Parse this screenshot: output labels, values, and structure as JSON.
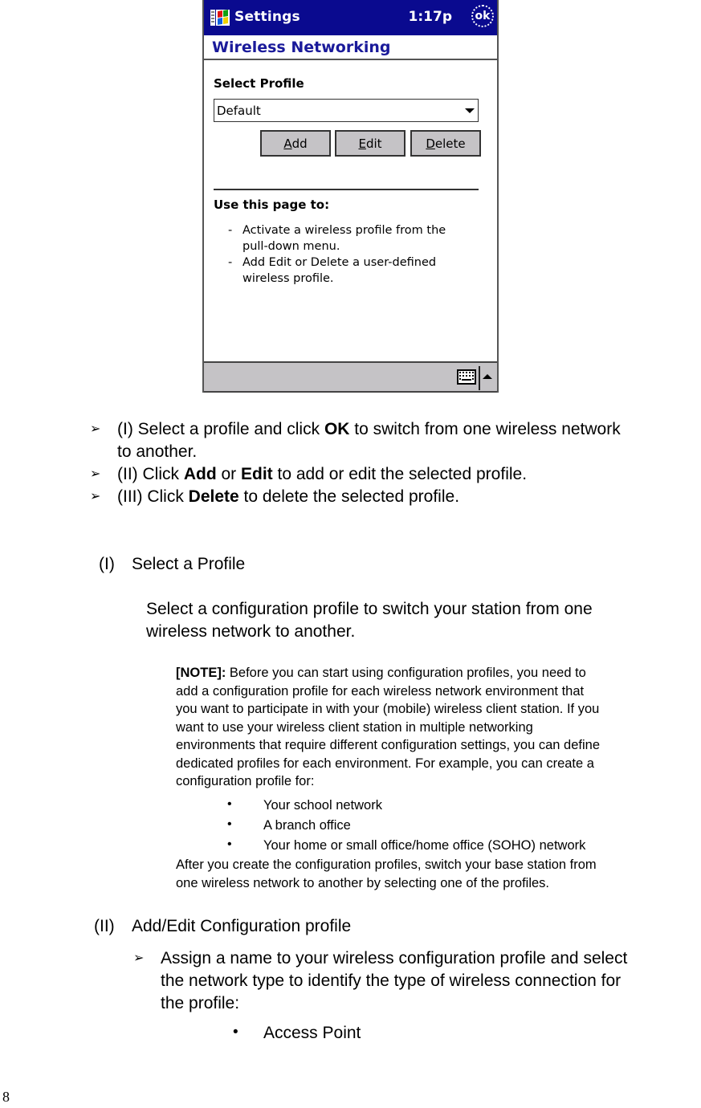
{
  "screenshot": {
    "title_bar": {
      "app_title": "Settings",
      "time": "1:17p",
      "ok_label": "ok",
      "start_icon": "windows-flag-icon",
      "color": "#0a0a8f"
    },
    "header": {
      "title": "Wireless Networking",
      "color": "#1a1a9a"
    },
    "select_profile_label": "Select Profile",
    "profile_dropdown": {
      "value": "Default"
    },
    "buttons": [
      {
        "accel": "A",
        "rest": "dd",
        "label": "Add"
      },
      {
        "accel": "E",
        "rest": "dit",
        "label": "Edit"
      },
      {
        "accel": "D",
        "rest": "elete",
        "label": "Delete"
      }
    ],
    "help": {
      "heading": "Use this page to:",
      "items": [
        {
          "dash": "-",
          "text": "Activate a wireless profile from the pull-down menu."
        },
        {
          "dash": "-",
          "text": "Add Edit or Delete a user-defined wireless profile."
        }
      ]
    },
    "bottom_bar": {
      "keyboard_icon": "keyboard-icon",
      "sip_arrow": "sip-up-arrow-icon"
    }
  },
  "instructions": [
    {
      "bullet": "➢",
      "pre": "(I) Select a profile and click ",
      "bold": "OK",
      "post": " to switch from one wireless network",
      "line2": "to another."
    },
    {
      "bullet": "➢",
      "pre": "(II) Click ",
      "bold": "Add",
      "mid": " or ",
      "bold2": "Edit",
      "post": " to add or edit the selected profile."
    },
    {
      "bullet": "➢",
      "pre": "(III) Click ",
      "bold": "Delete",
      "post": " to delete the selected profile."
    }
  ],
  "section1": {
    "numeral": "(I)",
    "heading": "Select a Profile",
    "para_line1": "Select a configuration profile to switch your station from one",
    "para_line2": "wireless network to another.",
    "note": {
      "label": "[NOTE]:",
      "lines": [
        " Before you can start using configuration profiles, you need to",
        "add a configuration profile for each wireless network environment that",
        "you want to participate in with your (mobile) wireless client station. If you",
        "want to use your wireless client station in multiple networking",
        "environments that require different configuration settings, you can define",
        "dedicated profiles for each environment. For example, you can create a",
        "configuration profile for:"
      ],
      "bullets": [
        "Your school network",
        "A branch office",
        "Your home or small office/home office (SOHO) network"
      ],
      "after_lines": [
        "After you create the configuration profiles, switch your base station from",
        "one wireless network to another by selecting one of the profiles."
      ]
    }
  },
  "section2": {
    "numeral": "(II)",
    "heading": "Add/Edit Configuration profile",
    "bullet": "➢",
    "lines": [
      "Assign a name to your wireless configuration profile and select",
      "the network type to identify the type of wireless connection for",
      "the profile:"
    ],
    "sub_bullets": [
      "Access Point"
    ]
  },
  "page_number": "8"
}
